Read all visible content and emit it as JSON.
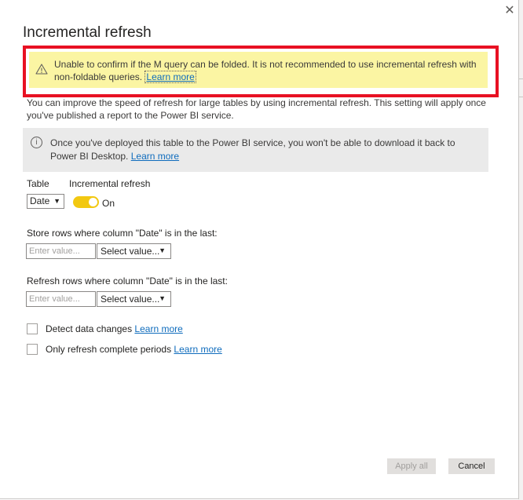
{
  "dialog": {
    "title": "Incremental refresh",
    "close_glyph": "✕",
    "warning": {
      "text": "Unable to confirm if the M query can be folded. It is not recommended to use incremental refresh with non-foldable queries.",
      "link": "Learn more",
      "icon": "warning-icon"
    },
    "description": "You can improve the speed of refresh for large tables by using incremental refresh. This setting will apply once you've published a report to the Power BI service.",
    "info": {
      "text": "Once you've deployed this table to the Power BI service, you won't be able to download it back to Power BI Desktop.",
      "link": "Learn more",
      "icon": "info-icon"
    },
    "table_label": "Table",
    "table_value": "Date",
    "incremental_label": "Incremental refresh",
    "toggle_state": "On",
    "store": {
      "label": "Store rows where column \"Date\" is in the last:",
      "input_placeholder": "Enter value...",
      "select_value": "Select value..."
    },
    "refresh": {
      "label": "Refresh rows where column \"Date\" is in the last:",
      "input_placeholder": "Enter value...",
      "select_value": "Select value..."
    },
    "detect": {
      "label": "Detect data changes",
      "link": "Learn more"
    },
    "complete": {
      "label": "Only refresh complete periods",
      "link": "Learn more"
    },
    "buttons": {
      "apply": "Apply all",
      "cancel": "Cancel"
    },
    "colors": {
      "accent_toggle": "#f2c811",
      "warning_bg": "#fbf5a3",
      "highlight_border": "#e81123",
      "link": "#0f6cbd"
    }
  }
}
